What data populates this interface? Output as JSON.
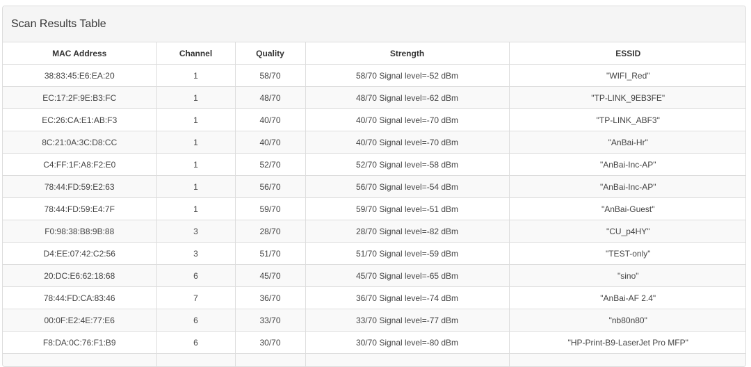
{
  "panel": {
    "title": "Scan Results Table"
  },
  "table": {
    "headers": [
      "MAC Address",
      "Channel",
      "Quality",
      "Strength",
      "ESSID"
    ],
    "rows": [
      [
        "38:83:45:E6:EA:20",
        "1",
        "58/70",
        "58/70 Signal level=-52 dBm",
        "\"WIFI_Red\""
      ],
      [
        "EC:17:2F:9E:B3:FC",
        "1",
        "48/70",
        "48/70 Signal level=-62 dBm",
        "\"TP-LINK_9EB3FE\""
      ],
      [
        "EC:26:CA:E1:AB:F3",
        "1",
        "40/70",
        "40/70 Signal level=-70 dBm",
        "\"TP-LINK_ABF3\""
      ],
      [
        "8C:21:0A:3C:D8:CC",
        "1",
        "40/70",
        "40/70 Signal level=-70 dBm",
        "\"AnBai-Hr\""
      ],
      [
        "C4:FF:1F:A8:F2:E0",
        "1",
        "52/70",
        "52/70 Signal level=-58 dBm",
        "\"AnBai-Inc-AP\""
      ],
      [
        "78:44:FD:59:E2:63",
        "1",
        "56/70",
        "56/70 Signal level=-54 dBm",
        "\"AnBai-Inc-AP\""
      ],
      [
        "78:44:FD:59:E4:7F",
        "1",
        "59/70",
        "59/70 Signal level=-51 dBm",
        "\"AnBai-Guest\""
      ],
      [
        "F0:98:38:B8:9B:88",
        "3",
        "28/70",
        "28/70 Signal level=-82 dBm",
        "\"CU_p4HY\""
      ],
      [
        "D4:EE:07:42:C2:56",
        "3",
        "51/70",
        "51/70 Signal level=-59 dBm",
        "\"TEST-only\""
      ],
      [
        "20:DC:E6:62:18:68",
        "6",
        "45/70",
        "45/70 Signal level=-65 dBm",
        "\"sino\""
      ],
      [
        "78:44:FD:CA:83:46",
        "7",
        "36/70",
        "36/70 Signal level=-74 dBm",
        "\"AnBai-AF 2.4\""
      ],
      [
        "00:0F:E2:4E:77:E6",
        "6",
        "33/70",
        "33/70 Signal level=-77 dBm",
        "\"nb80n80\""
      ],
      [
        "F8:DA:0C:76:F1:B9",
        "6",
        "30/70",
        "30/70 Signal level=-80 dBm",
        "\"HP-Print-B9-LaserJet Pro MFP\""
      ],
      [
        "",
        "",
        "",
        "",
        ""
      ]
    ]
  }
}
